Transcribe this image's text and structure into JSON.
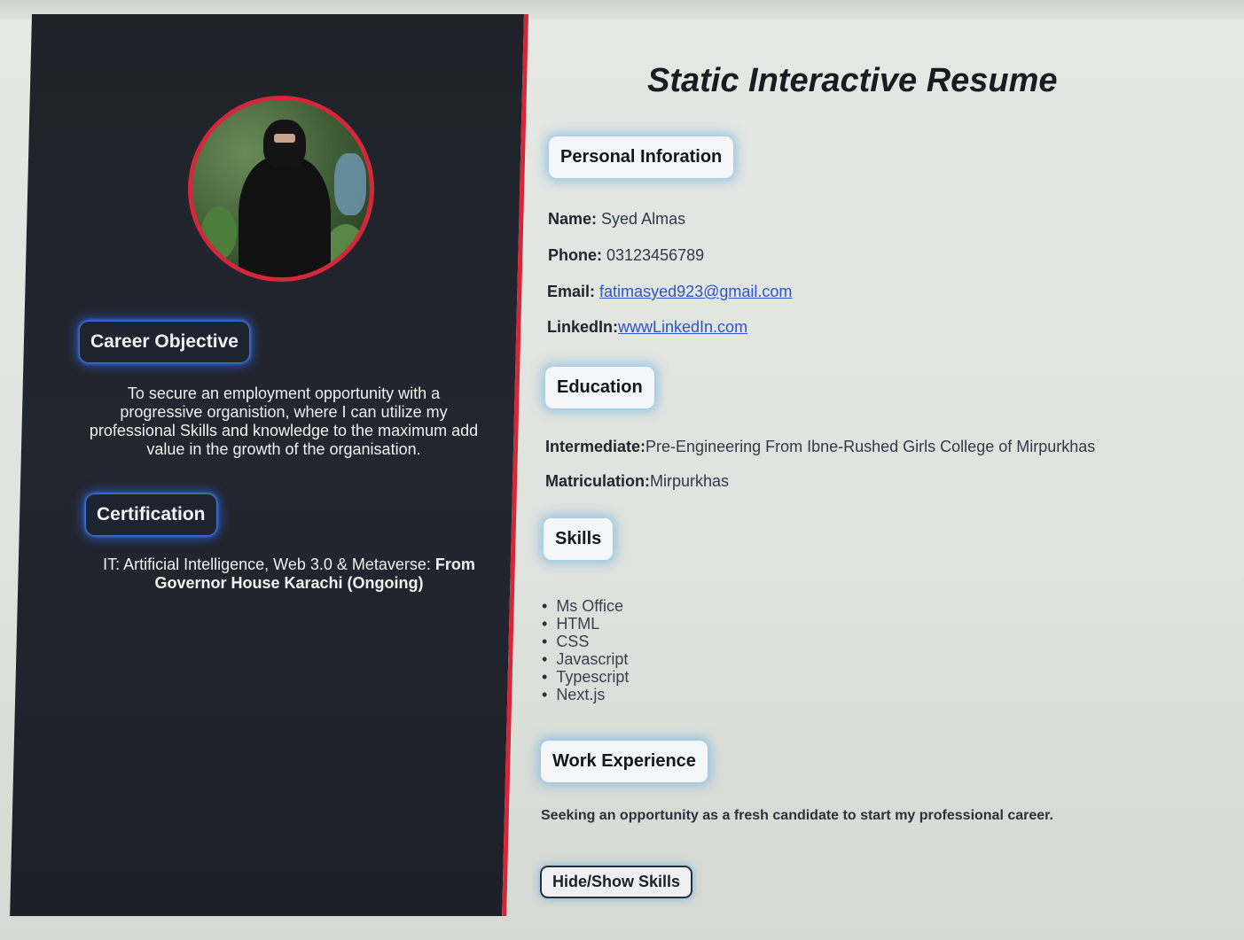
{
  "page": {
    "title": "Static Interactive Resume"
  },
  "sidebar": {
    "avatar_alt": "profile photo",
    "career": {
      "heading": "Career Objective",
      "text": "To secure an employment opportunity with a progressive organistion, where I can utilize my professional Skills and knowledge to the maximum add value in the growth of the organisation."
    },
    "certification": {
      "heading": "Certification",
      "text_prefix": "IT: Artificial Intelligence, Web 3.0 & Metaverse: ",
      "text_bold": "From Governor House Karachi (Ongoing)"
    }
  },
  "personal": {
    "heading": "Personal Inforation",
    "name_label": "Name:",
    "name_value": " Syed Almas",
    "phone_label": "Phone:",
    "phone_value": " 03123456789",
    "email_label": "Email:",
    "email_value": "fatimasyed923@gmail.com",
    "linkedin_label": "LinkedIn:",
    "linkedin_value": "wwwLinkedIn.com"
  },
  "education": {
    "heading": "Education",
    "intermediate_label": "Intermediate:",
    "intermediate_value": "Pre-Engineering From Ibne-Rushed Girls College of Mirpurkhas",
    "matric_label": "Matriculation:",
    "matric_value": "Mirpurkhas"
  },
  "skills": {
    "heading": "Skills",
    "items": [
      "Ms Office",
      "HTML",
      "CSS",
      "Javascript",
      "Typescript",
      "Next.js"
    ]
  },
  "work": {
    "heading": "Work Experience",
    "text": "Seeking an opportunity as a fresh candidate to start my professional career."
  },
  "actions": {
    "toggle_label": "Hide/Show Skills"
  },
  "colors": {
    "accent_red": "#d3283a",
    "sidebar_bg": "#1f2229",
    "glow_blue": "#2f6bff",
    "link_blue": "#2f54c8"
  }
}
